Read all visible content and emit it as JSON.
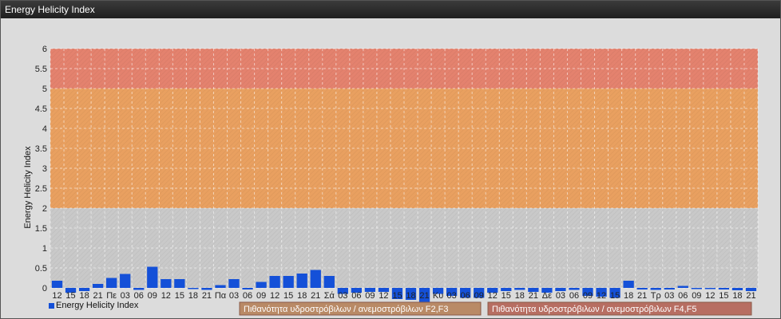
{
  "window": {
    "title": "Energy Helicity Index"
  },
  "colors": {
    "bar": "#1450d8",
    "band_low": "#c9c9c9",
    "band_mid": "#e9a060",
    "band_high": "#e4826e",
    "legend_f2f3": "#b98a66",
    "legend_f4f5": "#b76e62"
  },
  "chart_data": {
    "type": "bar",
    "title": "",
    "ylabel": "Energy Helicity Index",
    "ylim": [
      0,
      6
    ],
    "yticks": [
      "0",
      "0.5",
      "1",
      "1.5",
      "2",
      "2.5",
      "3",
      "3.5",
      "4",
      "4.5",
      "5",
      "5.5",
      "6"
    ],
    "grid": true,
    "categories": [
      "12",
      "15",
      "18",
      "21",
      "Πε",
      "03",
      "06",
      "09",
      "12",
      "15",
      "18",
      "21",
      "Πα",
      "03",
      "06",
      "09",
      "12",
      "15",
      "18",
      "21",
      "Σά",
      "03",
      "06",
      "09",
      "12",
      "15",
      "18",
      "21",
      "Κυ",
      "03",
      "06",
      "09",
      "12",
      "15",
      "18",
      "21",
      "Δε",
      "03",
      "06",
      "09",
      "12",
      "15",
      "18",
      "21",
      "Τρ",
      "03",
      "06",
      "09",
      "12",
      "15",
      "18",
      "21"
    ],
    "series": [
      {
        "name": "Energy Helicity Index",
        "values": [
          0.18,
          -0.12,
          -0.08,
          0.1,
          0.25,
          0.35,
          -0.05,
          0.53,
          0.22,
          0.22,
          -0.03,
          -0.05,
          0.07,
          0.22,
          -0.04,
          0.15,
          0.3,
          0.3,
          0.36,
          0.45,
          0.3,
          -0.15,
          -0.12,
          -0.1,
          -0.1,
          -0.28,
          -0.3,
          -0.35,
          -0.15,
          -0.2,
          -0.25,
          -0.25,
          -0.12,
          -0.08,
          -0.05,
          -0.1,
          -0.12,
          -0.08,
          -0.05,
          -0.2,
          -0.22,
          -0.25,
          0.18,
          -0.04,
          -0.05,
          -0.04,
          0.05,
          -0.03,
          -0.03,
          -0.04,
          -0.06,
          -0.08
        ]
      }
    ],
    "bands": [
      {
        "from": 0,
        "to": 2,
        "color": "#c9c9c9",
        "label": ""
      },
      {
        "from": 2,
        "to": 5,
        "color": "#e9a060",
        "label": "Πιθανότητα υδροστρόβιλων / ανεμοστρόβιλων F2,F3"
      },
      {
        "from": 5,
        "to": 6,
        "color": "#e4826e",
        "label": "Πιθανότητα υδροστρόβιλων / ανεμοστρόβιλων F4,F5"
      }
    ],
    "legend_position": "bottom"
  }
}
